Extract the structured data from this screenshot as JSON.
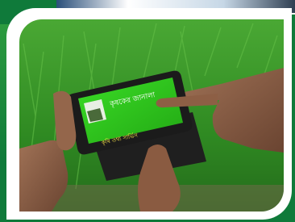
{
  "image": {
    "subject": "Hands holding a smartphone over a green paddy field, finger tapping a green app screen",
    "palette": {
      "border_green": "#0f7a3a",
      "frame_white": "#ffffff",
      "grass_green": "#3c9c2a",
      "screen_green": "#2fd21c",
      "phone_black": "#1b1b1b",
      "skin": "#8a5e43"
    },
    "phone_screen": {
      "heading_text": "কৃষকের জানালা",
      "body_text": "কৃষি তথ্য সার্ভিস"
    }
  }
}
